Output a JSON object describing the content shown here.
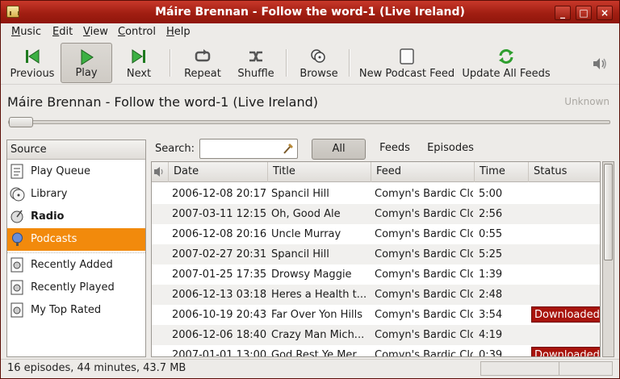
{
  "window": {
    "title": "Máire Brennan - Follow the word-1 (Live Ireland)",
    "controls": [
      "_",
      "□",
      "×"
    ]
  },
  "menubar": {
    "items": [
      "Music",
      "Edit",
      "View",
      "Control",
      "Help"
    ]
  },
  "toolbar": {
    "previous": "Previous",
    "play": "Play",
    "next": "Next",
    "repeat": "Repeat",
    "shuffle": "Shuffle",
    "browse": "Browse",
    "new_feed": "New Podcast Feed",
    "update_feeds": "Update All Feeds"
  },
  "now_playing": {
    "title": "Máire Brennan - Follow the word-1 (Live Ireland)",
    "album": "Unknown"
  },
  "sidebar": {
    "header": "Source",
    "items": [
      {
        "label": "Play Queue",
        "icon": "play-queue-icon"
      },
      {
        "label": "Library",
        "icon": "library-icon"
      },
      {
        "label": "Radio",
        "icon": "radio-icon"
      },
      {
        "label": "Podcasts",
        "icon": "podcast-icon"
      },
      {
        "label": "Recently Added",
        "icon": "playlist-icon"
      },
      {
        "label": "Recently Played",
        "icon": "playlist-icon"
      },
      {
        "label": "My Top Rated",
        "icon": "playlist-icon"
      }
    ]
  },
  "search": {
    "label": "Search:",
    "value": "",
    "filters": [
      "All",
      "Feeds",
      "Episodes"
    ]
  },
  "table": {
    "columns": [
      "Date",
      "Title",
      "Feed",
      "Time",
      "Status"
    ],
    "rows": [
      {
        "date": "2006-12-08 20:17",
        "title": "Spancil Hill",
        "feed": "Comyn's Bardic Clo",
        "time": "5:00",
        "status": ""
      },
      {
        "date": "2007-03-11 12:15",
        "title": "Oh, Good Ale",
        "feed": "Comyn's Bardic Clo",
        "time": "2:56",
        "status": ""
      },
      {
        "date": "2006-12-08 20:16",
        "title": "Uncle Murray",
        "feed": "Comyn's Bardic Clo",
        "time": "0:55",
        "status": ""
      },
      {
        "date": "2007-02-27 20:31",
        "title": "Spancil Hill",
        "feed": "Comyn's Bardic Clo",
        "time": "5:25",
        "status": ""
      },
      {
        "date": "2007-01-25 17:35",
        "title": "Drowsy Maggie",
        "feed": "Comyn's Bardic Clo",
        "time": "1:39",
        "status": ""
      },
      {
        "date": "2006-12-13 03:18",
        "title": "Heres a Health t...",
        "feed": "Comyn's Bardic Clo",
        "time": "2:48",
        "status": ""
      },
      {
        "date": "2006-10-19 20:43",
        "title": "Far Over Yon Hills",
        "feed": "Comyn's Bardic Clo",
        "time": "3:54",
        "status": "Downloaded"
      },
      {
        "date": "2006-12-06 18:40",
        "title": "Crazy Man Mich...",
        "feed": "Comyn's Bardic Clo",
        "time": "4:19",
        "status": ""
      },
      {
        "date": "2007-01-01 13:00",
        "title": "God Rest Ye Mer...",
        "feed": "Comyn's Bardic Clo",
        "time": "0:39",
        "status": "Downloaded"
      }
    ]
  },
  "statusbar": {
    "text": "16 episodes, 44 minutes, 43.7 MB"
  },
  "colors": {
    "titlebar": "#a11e12",
    "selection": "#f28a0c",
    "downloaded_badge": "#a8140c"
  }
}
